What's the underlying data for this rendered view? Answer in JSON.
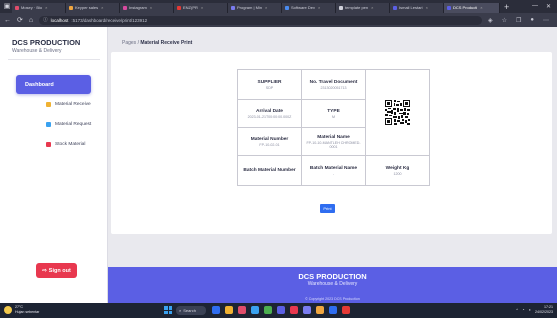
{
  "browser": {
    "tabs": [
      {
        "label": "Mosey · Bio",
        "color": "#e04d6b"
      },
      {
        "label": "Keyper sales",
        "color": "#f0a640"
      },
      {
        "label": "Instagram",
        "color": "#d84aa0"
      },
      {
        "label": "ENZ(PR",
        "color": "#e53935"
      },
      {
        "label": "Program | Min",
        "color": "#7a7cf0"
      },
      {
        "label": "Software Dev",
        "color": "#4a8bf0"
      },
      {
        "label": "template pen",
        "color": "#cfd0da"
      },
      {
        "label": "Ismail Lestari",
        "color": "#5b5fe4"
      },
      {
        "label": "DCS Producti",
        "color": "#5b5fe4",
        "active": true
      }
    ],
    "new_tab": "+",
    "url_host": "localhost",
    "url_path": ":5173/dashboard/receive/print/123912"
  },
  "sidebar": {
    "brand": "DCS PRODUCTION",
    "subtitle": "Warehouse & Delivery",
    "active_item": "Dashboard",
    "items": [
      {
        "label": "Material Receive",
        "color": "#f0b232"
      },
      {
        "label": "Material Request",
        "color": "#3aa2f0"
      },
      {
        "label": "Stock Material",
        "color": "#e8384f"
      }
    ],
    "signout": "Sign out"
  },
  "breadcrumb": {
    "root": "Pages",
    "sep": " / ",
    "current": "Material Receive Print"
  },
  "document": {
    "supplier_label": "SUPPLIER",
    "supplier_value": "SDP",
    "travel_label": "No. Travel Document",
    "travel_value": "2313020051713",
    "arrival_label": "Arrival Date",
    "arrival_value": "2023-01-21T00:00:00.000Z",
    "type_label": "TYPE",
    "type_value": "M",
    "matnum_label": "Material Number",
    "matnum_value": "FP-10-02-01",
    "matname_label": "Material Name",
    "matname_value": "FP-10-10-MANTLEH CHROMED-0001",
    "batch_label": "Batch Material Number",
    "batch_value": "",
    "batchname_label": "Batch Material Name",
    "batchname_value": "-",
    "weight_label": "Weight Kg",
    "weight_value": "1200"
  },
  "print_button": "Print",
  "footer": {
    "title": "DCS PRODUCTION",
    "subtitle": "Warehouse & Delivery",
    "copyright": "© Copyright 2023 DCS Production"
  },
  "taskbar": {
    "temp": "27°C",
    "weather": "Hujan sebentar",
    "search": "Search",
    "time": "17:21",
    "date": "24/02/2023",
    "apps": [
      "#2f6df0",
      "#f0b232",
      "#e04d6b",
      "#3aa2f0",
      "#4caf50",
      "#5b5fe4",
      "#e8384f",
      "#7a7cf0",
      "#f0a640",
      "#2f6df0",
      "#e53935"
    ]
  }
}
